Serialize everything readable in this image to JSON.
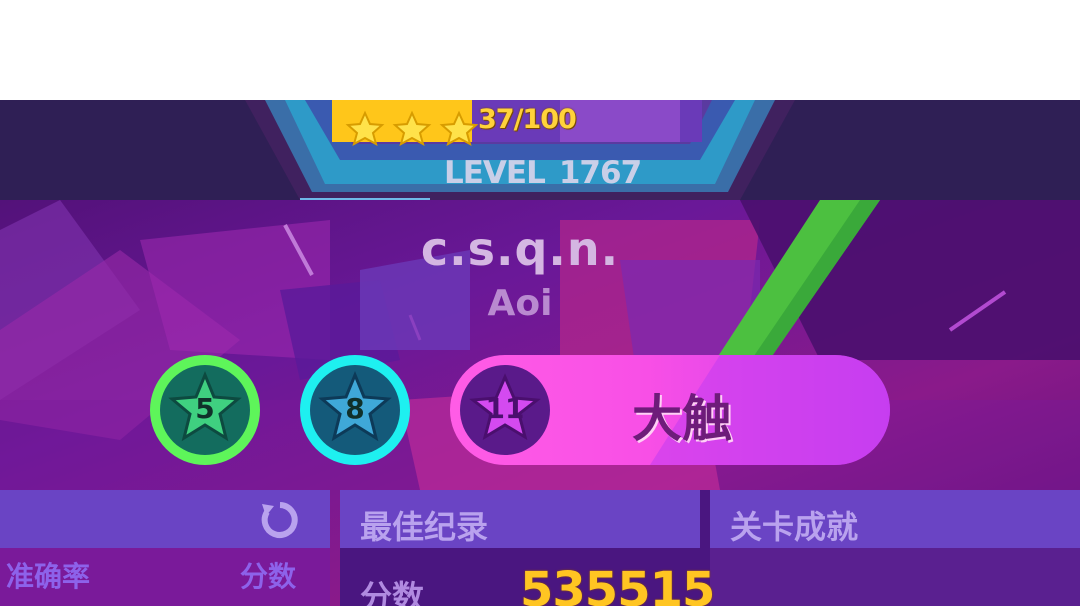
{
  "stars_label": "37/100",
  "level": {
    "prefix": "LEVEL",
    "number": "1767"
  },
  "player": {
    "name": "c.s.q.n.",
    "title": "Aoi"
  },
  "badges": [
    {
      "value": "5",
      "color": "#5ef55a"
    },
    {
      "value": "8",
      "color": "#1ef0f0"
    },
    {
      "value": "11",
      "color": "#ff5ce6"
    }
  ],
  "rank_label": "大触",
  "panels": {
    "left": {
      "col1": "准确率",
      "col2": "分数"
    },
    "middle": {
      "title": "最佳纪录",
      "score_label": "分数",
      "score_value": "535515"
    },
    "right": {
      "title": "关卡成就"
    }
  },
  "colors": {
    "star_gold": "#ffd23a",
    "panel_purple": "#6a44c4",
    "score": "#ffc522"
  }
}
